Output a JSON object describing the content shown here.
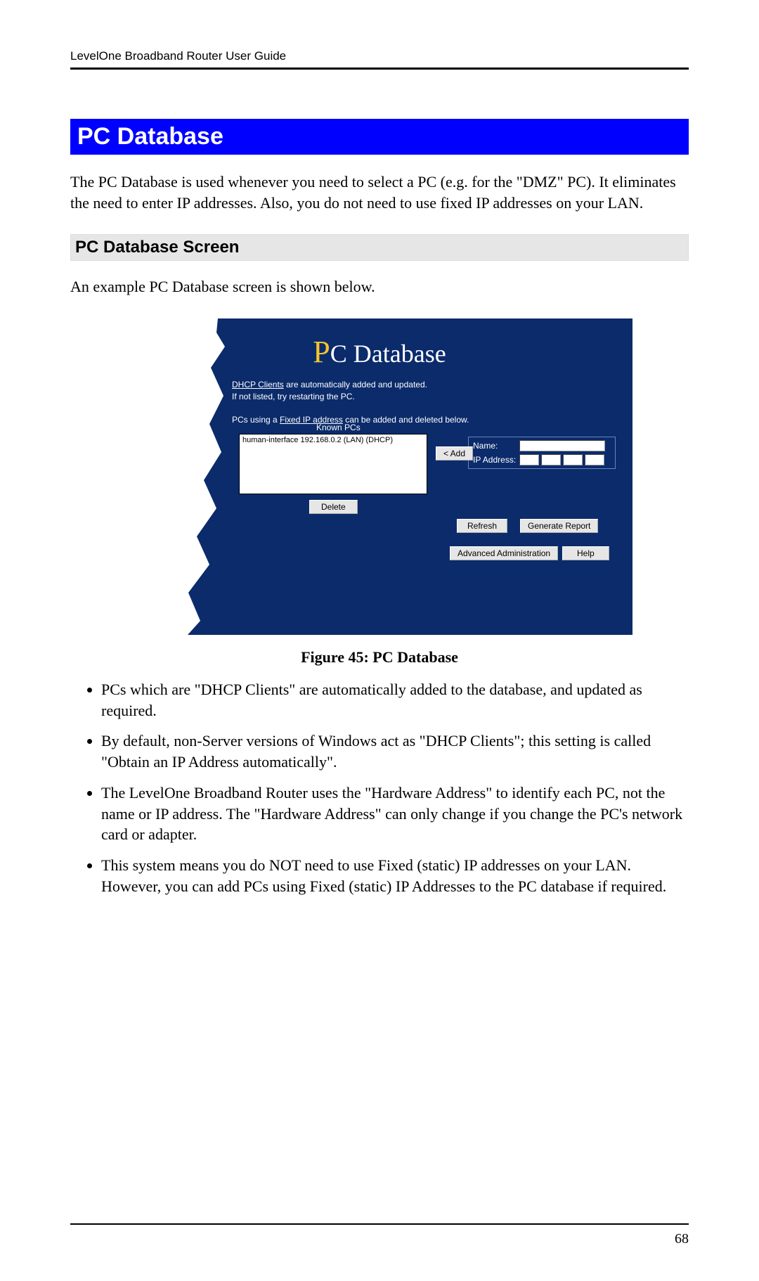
{
  "header": {
    "title": "LevelOne Broadband Router User Guide"
  },
  "section": {
    "title": "PC Database",
    "intro": "The PC Database is used whenever you need to select a PC (e.g. for the \"DMZ\" PC). It eliminates the need to enter IP addresses. Also, you do not need to use fixed IP addresses on your LAN."
  },
  "subsection": {
    "title": "PC Database Screen",
    "intro": "An example PC Database screen is shown below."
  },
  "figure": {
    "caption": "Figure 45: PC Database",
    "title_lead": "P",
    "title_rest": "C Database",
    "info_line1a": "DHCP Clients",
    "info_line1b": " are automatically added and updated.",
    "info_line2": "If not listed, try restarting the PC.",
    "info_line3a": "PCs using a ",
    "info_line3b": "Fixed IP address",
    "info_line3c": " can be added and deleted below.",
    "known_pcs_label": "Known PCs",
    "list_entry": "human-interface 192.168.0.2 (LAN) (DHCP)",
    "add_btn": "< Add",
    "delete_btn": "Delete",
    "refresh_btn": "Refresh",
    "report_btn": "Generate Report",
    "advanced_btn": "Advanced Administration",
    "help_btn": "Help",
    "name_label": "Name:",
    "ip_label": "IP Address:"
  },
  "bullets": [
    "PCs which are \"DHCP Clients\" are automatically added to the database, and updated as required.",
    "By default, non-Server versions of Windows act as \"DHCP Clients\"; this setting is called \"Obtain an IP Address automatically\".",
    "The LevelOne Broadband Router uses the \"Hardware Address\" to identify each PC, not the name or IP address. The \"Hardware Address\" can only change if you change the PC's network card or adapter.",
    "This system means you do NOT need to use Fixed (static) IP addresses on your LAN. However, you can add PCs using Fixed (static) IP Addresses to the PC database if required."
  ],
  "page_number": "68"
}
